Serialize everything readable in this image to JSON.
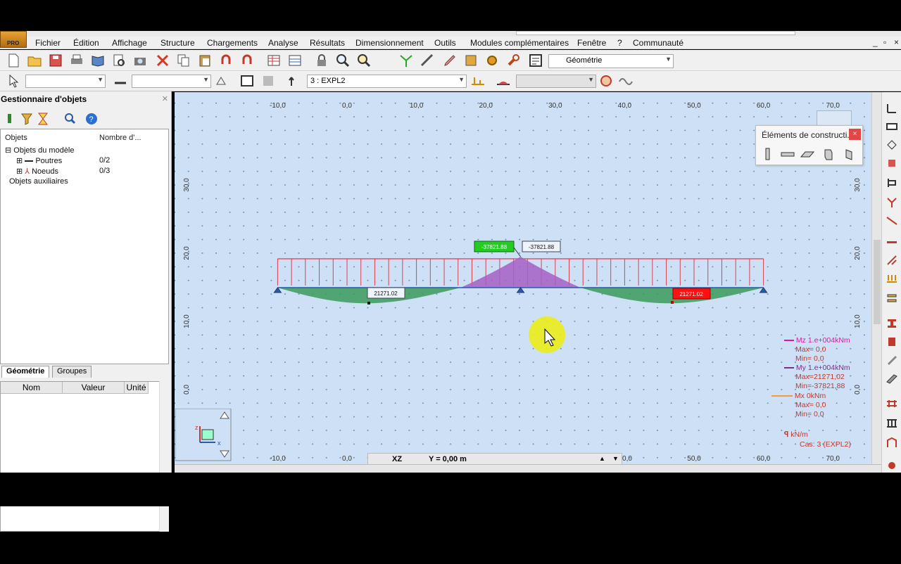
{
  "menu": [
    "Fichier",
    "Édition",
    "Affichage",
    "Structure",
    "Chargements",
    "Analyse",
    "Résultats",
    "Dimensionnement",
    "Outils",
    "Modules complémentaires",
    "Fenêtre",
    "?",
    "Communauté"
  ],
  "logo_text": "PRO",
  "window_controls": [
    "_",
    "▫",
    "×"
  ],
  "toolbar": {
    "view_combo": "Géométrie",
    "load_case": "3 : EXPL2",
    "load_case_icon": "load-case-icon"
  },
  "object_manager": {
    "title": "Gestionnaire d'objets",
    "col_objects": "Objets",
    "col_count": "Nombre d'...",
    "tree": [
      {
        "label": "Objets du modèle",
        "count": "",
        "level": 0
      },
      {
        "label": "Poutres",
        "count": "0/2",
        "level": 1
      },
      {
        "label": "Noeuds",
        "count": "0/3",
        "level": 1
      },
      {
        "label": "Objets auxiliaires",
        "count": "",
        "level": 0
      }
    ],
    "tabs": [
      "Géométrie",
      "Groupes"
    ],
    "grid_headers": [
      "Nom",
      "Valeur",
      "Unité"
    ]
  },
  "floating_toolbar": {
    "title": "Éléments de constructi...",
    "close": "×"
  },
  "coord_bar": {
    "plane": "XZ",
    "y_value": "Y = 0,00 m"
  },
  "axes": {
    "x_ticks": [
      "-10,0",
      "0,0",
      "10,0",
      "20,0",
      "30,0",
      "40,0",
      "50,0",
      "60,0",
      "70,0"
    ],
    "y_ticks": [
      "30,0",
      "20,0",
      "10,0",
      "0,0"
    ],
    "x_ticks_bottom": [
      "-10,0",
      "0,0",
      "0,0",
      "50,0",
      "60,0",
      "70,0"
    ]
  },
  "diagram": {
    "min_label": "-37821.88",
    "max_label_left": "21271.02",
    "max_label_right": "21271.02",
    "colors": {
      "load": "#d9414f",
      "positive": "#3a9a5c",
      "negative": "#a65fc4",
      "min_box": "#22cc22",
      "max_box": "#ff1111"
    }
  },
  "legend": {
    "mz": "Mz  1.e+004kNm",
    "mz_max": "Max=   0,0",
    "mz_min": "Min=   0,0",
    "my": "My  1.e+004kNm",
    "my_max": "Max=21271,02",
    "my_min": "Min=-37821,88",
    "mx": "Mx  0kNm",
    "mx_max": "Max=   0,0",
    "mx_min": "Min=   0,0",
    "unit": "kN/m",
    "case": "Cas: 3 (EXPL2)"
  }
}
